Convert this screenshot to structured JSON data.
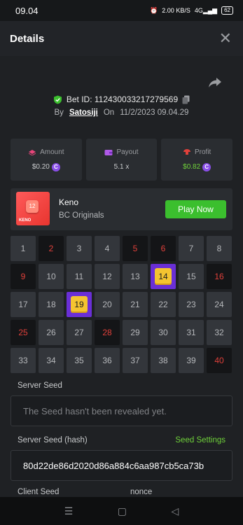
{
  "status": {
    "time": "09.04",
    "speed": "2.00",
    "speed_unit": "KB/S",
    "signal": "4G",
    "battery": "62"
  },
  "header": {
    "title": "Details"
  },
  "bet": {
    "id_label": "Bet ID: 112430033217279569",
    "by_label": "By",
    "user": "Satosiji",
    "on_label": "On",
    "datetime": "11/2/2023 09.04.29"
  },
  "stats": [
    {
      "label": "Amount",
      "value": "$0.20",
      "icon": "stack-icon"
    },
    {
      "label": "Payout",
      "value": "5.1 x",
      "icon": "wallet-icon"
    },
    {
      "label": "Profit",
      "value": "$0.82",
      "icon": "profit-icon"
    }
  ],
  "game": {
    "name": "Keno",
    "provider": "BC Originals",
    "play_label": "Play Now",
    "thumb_ball": "12",
    "thumb_text": "KENO"
  },
  "keno": {
    "numbers": [
      "1",
      "2",
      "3",
      "4",
      "5",
      "6",
      "7",
      "8",
      "9",
      "10",
      "11",
      "12",
      "13",
      "14",
      "15",
      "16",
      "17",
      "18",
      "19",
      "20",
      "21",
      "22",
      "23",
      "24",
      "25",
      "26",
      "27",
      "28",
      "29",
      "30",
      "31",
      "32",
      "33",
      "34",
      "35",
      "36",
      "37",
      "38",
      "39",
      "40"
    ],
    "hits": [
      "14",
      "19"
    ],
    "misses": [
      "2",
      "5",
      "6",
      "9",
      "16",
      "25",
      "28",
      "40"
    ]
  },
  "seeds": {
    "server_seed_label": "Server Seed",
    "server_seed_value": "The Seed hasn't been revealed yet.",
    "server_hash_label": "Server Seed (hash)",
    "seed_settings_label": "Seed Settings",
    "server_hash_value": "80d22de86d2020d86a884c6aa987cb5ca73b",
    "client_seed_label": "Client Seed",
    "nonce_label": "nonce"
  },
  "colors": {
    "accent_green": "#3bbf2e",
    "hit_purple": "#6a2fd6",
    "hit_yellow": "#f4c430",
    "miss_red": "#e0403a"
  }
}
